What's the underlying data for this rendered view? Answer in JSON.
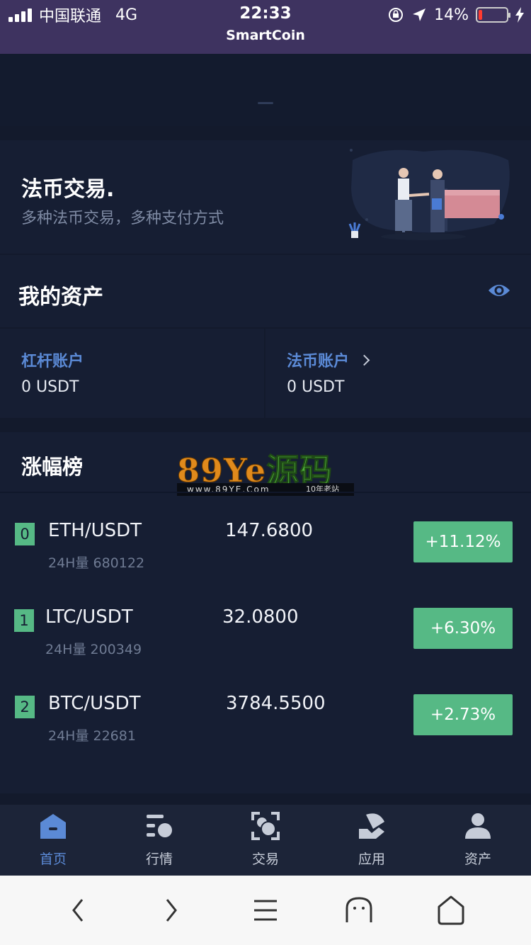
{
  "status_bar": {
    "carrier": "中国联通",
    "network": "4G",
    "time": "22:33",
    "app_name": "SmartCoin",
    "battery": "14%",
    "battery_level": 0.14
  },
  "promo": {
    "title": "法币交易.",
    "subtitle": "多种法币交易，多种支付方式"
  },
  "assets": {
    "title": "我的资产",
    "accounts": [
      {
        "label": "杠杆账户",
        "value": "0 USDT"
      },
      {
        "label": "法币账户",
        "value": "0 USDT"
      }
    ]
  },
  "gainers": {
    "title": "涨幅榜",
    "rows": [
      {
        "rank": "0",
        "pair": "ETH/USDT",
        "volume": "24H量 680122",
        "price": "147.6800",
        "change": "+11.12%"
      },
      {
        "rank": "1",
        "pair": "LTC/USDT",
        "volume": "24H量 200349",
        "price": "32.0800",
        "change": "+6.30%"
      },
      {
        "rank": "2",
        "pair": "BTC/USDT",
        "volume": "24H量 22681",
        "price": "3784.5500",
        "change": "+2.73%"
      }
    ]
  },
  "watermark": {
    "big_latin": "89Ye",
    "big_cn": "源码",
    "url": "www.89YE.Com",
    "tagline": "10年老站"
  },
  "tabs": [
    {
      "label": "首页",
      "icon": "home-icon"
    },
    {
      "label": "行情",
      "icon": "market-icon"
    },
    {
      "label": "交易",
      "icon": "trade-icon"
    },
    {
      "label": "应用",
      "icon": "apps-icon"
    },
    {
      "label": "资产",
      "icon": "user-icon"
    }
  ],
  "colors": {
    "background": "#131a2c",
    "panel": "#161e33",
    "status_bar": "#3e3360",
    "accent_blue": "#5b8ad6",
    "up_green": "#56b985",
    "tabbar": "#1c2438"
  }
}
